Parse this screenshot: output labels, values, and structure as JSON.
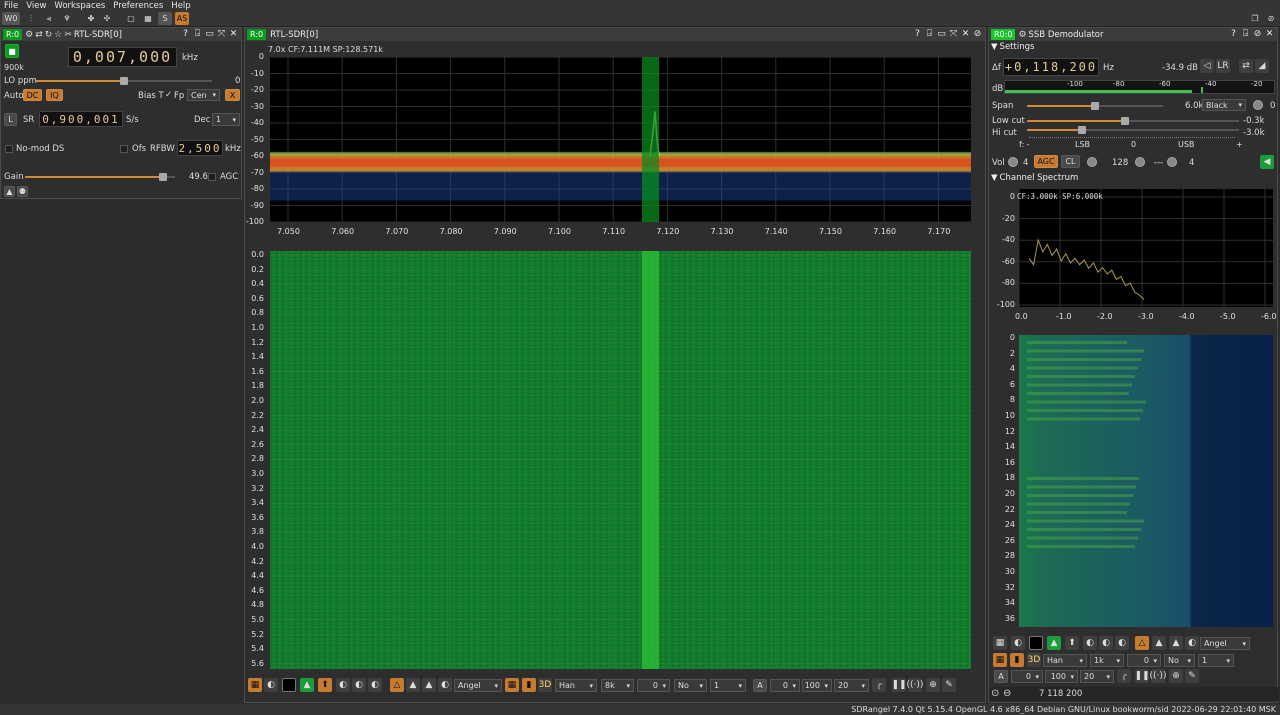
{
  "menu": [
    "File",
    "View",
    "Workspaces",
    "Preferences",
    "Help"
  ],
  "toolbar": {
    "workspace": "W0",
    "s_label": "S",
    "as_label": "AS"
  },
  "left": {
    "badge": "R:0",
    "title": "RTL-SDR[0]",
    "frequency": "0,007,000",
    "freq_unit": "kHz",
    "rate": "900k",
    "lo_ppm_label": "LO ppm",
    "lo_ppm_value": "0",
    "auto_label": "Auto",
    "dc_label": "DC",
    "iq_label": "IQ",
    "bias_label": "Bias T",
    "fp_label": "Fp",
    "cen_value": "Cen",
    "x_label": "X",
    "l_label": "L",
    "sr_label": "SR",
    "sr_value": "0,900,001",
    "sr_unit": "S/s",
    "dec_label": "Dec",
    "dec_value": "1",
    "nomod_label": "No-mod DS",
    "ofs_label": "Ofs",
    "rfbw_label": "RFBW",
    "rfbw_value": "2,500",
    "rfbw_unit": "kHz",
    "gain_label": "Gain",
    "gain_value": "49.6",
    "agc_label": "AGC",
    "gain_level": 0.92
  },
  "center": {
    "badge": "R:0",
    "title": "RTL-SDR[0]",
    "spectrum_info": "7.0x CF:7.111M SP:128.571k",
    "y_ticks": [
      "0",
      "-10",
      "-20",
      "-30",
      "-40",
      "-50",
      "-60",
      "-70",
      "-80",
      "-90",
      "-100"
    ],
    "x_ticks": [
      "7.050",
      "7.060",
      "7.070",
      "7.080",
      "7.090",
      "7.100",
      "7.110",
      "7.120",
      "7.130",
      "7.140",
      "7.150",
      "7.160",
      "7.170"
    ],
    "wf_ticks": [
      "0.0",
      "0.2",
      "0.4",
      "0.6",
      "0.8",
      "1.0",
      "1.2",
      "1.4",
      "1.6",
      "1.8",
      "2.0",
      "2.2",
      "2.4",
      "2.6",
      "2.8",
      "3.0",
      "3.2",
      "3.4",
      "3.6",
      "3.8",
      "4.0",
      "4.2",
      "4.4",
      "4.6",
      "4.8",
      "5.0",
      "5.2",
      "5.4",
      "5.6"
    ],
    "bottom": {
      "palette": "Angel",
      "window": "Han",
      "fft": "8k",
      "v0": "0",
      "no": "No",
      "one": "1",
      "a": "A",
      "v0b": "0",
      "v100": "100",
      "v20": "20"
    }
  },
  "right": {
    "badge": "R0:0",
    "title": "SSB Demodulator",
    "settings_label": "Settings",
    "df_label": "Δf",
    "df_value": "+0,118,200",
    "df_unit": "Hz",
    "db_value": "-34.9 dB",
    "lr_label": "LR",
    "db_label": "dB",
    "meter_ticks": [
      "-100",
      "-80",
      "-60",
      "-40",
      "-20",
      "0"
    ],
    "span_label": "Span",
    "span_value": "6.0k",
    "span_color": "Black",
    "span_right": "0",
    "lowcut_label": "Low cut",
    "lowcut_value": "-0.3k",
    "hicut_label": "Hi cut",
    "hicut_value": "-3.0k",
    "scale": [
      "f: -",
      "LSB",
      "0",
      "USB",
      "+"
    ],
    "vol_label": "Vol",
    "vol_value": "4",
    "agc_label": "AGC",
    "cl_label": "CL",
    "agc_value": "128",
    "dash_label": "---",
    "right_value": "4",
    "channel_label": "Channel Spectrum",
    "cs_info": "CF:3.000k SP:6.000k",
    "cs_y": [
      "0",
      "-20",
      "-40",
      "-60",
      "-80",
      "-100"
    ],
    "cs_x": [
      "0.0",
      "-1.0",
      "-2.0",
      "-3.0",
      "-4.0",
      "-5.0",
      "-6.0"
    ],
    "cs_wf": [
      "0",
      "2",
      "4",
      "6",
      "8",
      "10",
      "12",
      "14",
      "16",
      "18",
      "20",
      "22",
      "24",
      "26",
      "28",
      "30",
      "32",
      "34",
      "36"
    ],
    "ctrl": {
      "palette": "Angel",
      "window": "Han",
      "fft": "1k",
      "v0": "0",
      "no": "No",
      "one": "1",
      "a": "A",
      "v0b": "0",
      "v100": "100",
      "v20": "20"
    },
    "freq_display": "7 118 200"
  },
  "status": "SDRangel 7.4.0 Qt 5.15.4 OpenGL 4.6 x86_64 Debian GNU/Linux bookworm/sid  2022-06-29 22:01:40 MSK",
  "colors": {
    "accent": "#c77b30",
    "badge": "#0c9c1d",
    "waterfall": "#0f7a2a"
  }
}
